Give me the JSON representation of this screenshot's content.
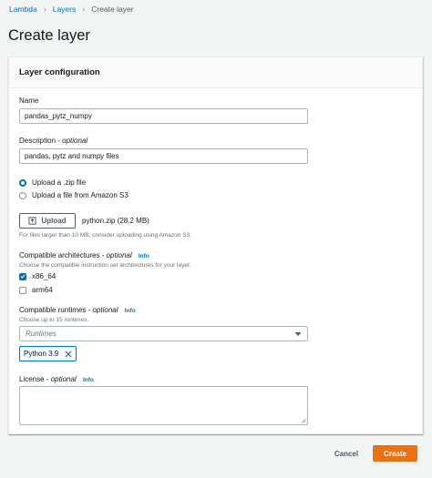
{
  "breadcrumb": {
    "items": [
      "Lambda",
      "Layers",
      "Create layer"
    ]
  },
  "page": {
    "title": "Create layer"
  },
  "panel": {
    "title": "Layer configuration"
  },
  "form": {
    "name": {
      "label": "Name",
      "value": "pandas_pytz_numpy"
    },
    "description": {
      "label": "Description",
      "optional": "optional",
      "value": "pandas, pytz and numpy files"
    },
    "source": {
      "options": [
        "Upload a .zip file",
        "Upload a file from Amazon S3"
      ],
      "selected_index": 0
    },
    "upload": {
      "button_label": "Upload",
      "file_name": "python.zip (28.2 MB)",
      "hint": "For files larger than 10 MB, consider uploading using Amazon S3."
    },
    "architectures": {
      "label": "Compatible architectures",
      "optional": "optional",
      "info": "Info",
      "hint": "Choose the compatible instruction set architectures for your layer.",
      "options": [
        {
          "label": "x86_64",
          "checked": true
        },
        {
          "label": "arm64",
          "checked": false
        }
      ]
    },
    "runtimes": {
      "label": "Compatible runtimes",
      "optional": "optional",
      "info": "Info",
      "hint": "Choose up to 15 runtimes.",
      "placeholder": "Runtimes",
      "selected": [
        "Python 3.9"
      ]
    },
    "license": {
      "label": "License",
      "optional": "optional",
      "info": "Info",
      "value": ""
    }
  },
  "actions": {
    "cancel_label": "Cancel",
    "create_label": "Create"
  },
  "icons": {
    "breadcrumb_separator": "chevron-right-icon",
    "upload": "upload-icon",
    "select_caret": "caret-down-icon",
    "token_dismiss": "close-icon",
    "resize": "resize-grip-icon"
  },
  "colors": {
    "link": "#0073bb",
    "primary_button": "#ec7211",
    "page_background": "#f2f3f3",
    "token_background": "#f1faff"
  }
}
